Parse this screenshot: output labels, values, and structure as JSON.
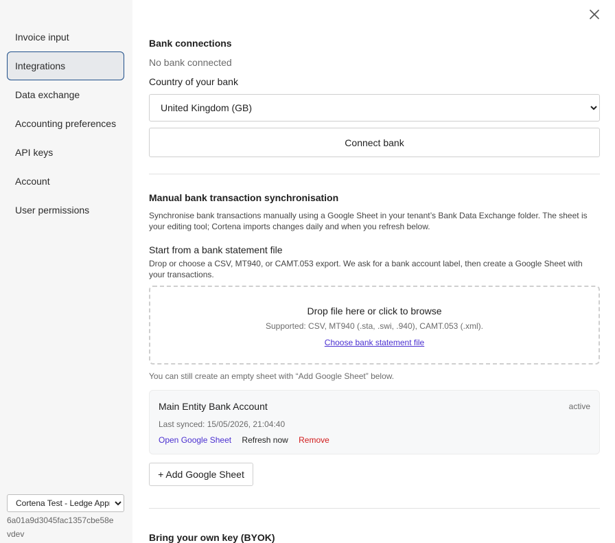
{
  "sidebar": {
    "items": [
      {
        "label": "Invoice input"
      },
      {
        "label": "Integrations",
        "active": true
      },
      {
        "label": "Data exchange"
      },
      {
        "label": "Accounting preferences"
      },
      {
        "label": "API keys"
      },
      {
        "label": "Account"
      },
      {
        "label": "User permissions"
      }
    ],
    "tenant_selected": "Cortena Test - Ledge Approvals",
    "tenant_id": "6a01a9d3045fac1357cbe58e",
    "environment": "vdev"
  },
  "bank_connections": {
    "title": "Bank connections",
    "status": "No bank connected",
    "country_label": "Country of your bank",
    "country_selected": "United Kingdom (GB)",
    "connect_label": "Connect bank"
  },
  "manual_sync": {
    "title": "Manual bank transaction synchronisation",
    "description": "Synchronise bank transactions manually using a Google Sheet in your tenant’s Bank Data Exchange folder. The sheet is your editing tool; Cortena imports changes daily and when you refresh below.",
    "statement_title": "Start from a bank statement file",
    "statement_desc": "Drop or choose a CSV, MT940, or CAMT.053 export. We ask for a bank account label, then create a Google Sheet with your transactions.",
    "dropzone_title": "Drop file here or click to browse",
    "dropzone_supported": "Supported: CSV, MT940 (.sta, .swi, .940), CAMT.053 (.xml).",
    "dropzone_link": "Choose bank statement file",
    "empty_sheet_note": "You can still create an empty sheet with “Add Google Sheet” below.",
    "account": {
      "name": "Main Entity Bank Account",
      "status": "active",
      "last_synced": "Last synced: 15/05/2026, 21:04:40",
      "open_label": "Open Google Sheet",
      "refresh_label": "Refresh now",
      "remove_label": "Remove"
    },
    "add_sheet_label": "+ Add Google Sheet"
  },
  "byok": {
    "title": "Bring your own key (BYOK)"
  },
  "icons": {
    "close": "close-icon",
    "chevron": "chevron-down-icon"
  },
  "colors": {
    "accent_link": "#4a2fd0",
    "danger": "#d11a1a",
    "active_border": "#1f4f8a"
  }
}
